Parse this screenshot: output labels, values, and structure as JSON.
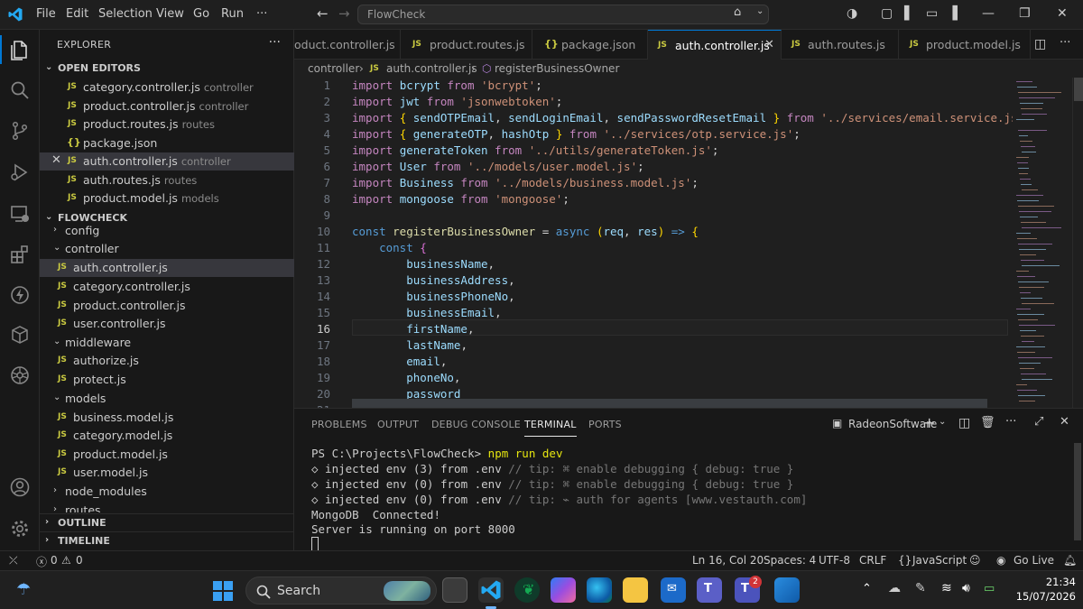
{
  "menu": [
    "File",
    "Edit",
    "Selection",
    "View",
    "Go",
    "Run",
    "···"
  ],
  "command_center": "FlowCheck",
  "explorer": {
    "title": "EXPLORER",
    "open_editors_label": "OPEN EDITORS",
    "open_editors": [
      {
        "name": "category.controller.js",
        "desc": "controller",
        "kind": "js"
      },
      {
        "name": "product.controller.js",
        "desc": "controller",
        "kind": "js"
      },
      {
        "name": "product.routes.js",
        "desc": "routes",
        "kind": "js"
      },
      {
        "name": "package.json",
        "desc": "",
        "kind": "json"
      },
      {
        "name": "auth.controller.js",
        "desc": "controller",
        "kind": "js"
      },
      {
        "name": "auth.routes.js",
        "desc": "routes",
        "kind": "js"
      },
      {
        "name": "product.model.js",
        "desc": "models",
        "kind": "js"
      }
    ],
    "workspace_label": "FLOWCHECK",
    "tree": [
      {
        "name": "config",
        "type": "folder",
        "open": false
      },
      {
        "name": "controller",
        "type": "folder",
        "open": true
      },
      {
        "name": "auth.controller.js",
        "type": "file"
      },
      {
        "name": "category.controller.js",
        "type": "file"
      },
      {
        "name": "product.controller.js",
        "type": "file"
      },
      {
        "name": "user.controller.js",
        "type": "file"
      },
      {
        "name": "middleware",
        "type": "folder",
        "open": true
      },
      {
        "name": "authorize.js",
        "type": "file"
      },
      {
        "name": "protect.js",
        "type": "file"
      },
      {
        "name": "models",
        "type": "folder",
        "open": true
      },
      {
        "name": "business.model.js",
        "type": "file"
      },
      {
        "name": "category.model.js",
        "type": "file"
      },
      {
        "name": "product.model.js",
        "type": "file"
      },
      {
        "name": "user.model.js",
        "type": "file"
      },
      {
        "name": "node_modules",
        "type": "folder",
        "open": false
      },
      {
        "name": "routes",
        "type": "folder",
        "open": false
      }
    ],
    "outline_label": "OUTLINE",
    "timeline_label": "TIMELINE"
  },
  "tabs": [
    {
      "name": "oduct.controller.js",
      "kind": "js",
      "active": false
    },
    {
      "name": "product.routes.js",
      "kind": "js",
      "active": false
    },
    {
      "name": "package.json",
      "kind": "json",
      "active": false
    },
    {
      "name": "auth.controller.js",
      "kind": "js",
      "active": true
    },
    {
      "name": "auth.routes.js",
      "kind": "js",
      "active": false
    },
    {
      "name": "product.model.js",
      "kind": "js",
      "active": false
    }
  ],
  "breadcrumb": [
    "controller",
    "auth.controller.js",
    "registerBusinessOwner"
  ],
  "code": {
    "line_numbers": [
      "1",
      "2",
      "3",
      "4",
      "5",
      "6",
      "7",
      "8",
      "9",
      "10",
      "11",
      "12",
      "13",
      "14",
      "15",
      "16",
      "17",
      "18",
      "19",
      "20",
      "21"
    ],
    "current_line": 16,
    "last_partial": "} = req.body;"
  },
  "panel": {
    "tabs": [
      "PROBLEMS",
      "OUTPUT",
      "DEBUG CONSOLE",
      "TERMINAL",
      "PORTS"
    ],
    "active_tab": "TERMINAL",
    "terminal_name": "RadeonSoftware",
    "lines": [
      {
        "prompt": "PS C:\\Projects\\FlowCheck>",
        "cmd": " npm run dev"
      },
      {
        "a": "◇ injected env (3) from .env ",
        "b": "// tip: ⌘ enable debugging { debug: true }"
      },
      {
        "a": "◇ injected env (0) from .env ",
        "b": "// tip: ⌘ enable debugging { debug: true }"
      },
      {
        "a": "◇ injected env (0) from .env ",
        "b": "// tip: ⌁ auth for agents [www.vestauth.com]"
      },
      {
        "a": "MongoDB  Connected!",
        "b": ""
      },
      {
        "a": "Server is running on port 8000",
        "b": ""
      }
    ]
  },
  "status": {
    "errors": "0",
    "warnings": "0",
    "position": "Ln 16, Col 20",
    "spaces": "Spaces: 4",
    "encoding": "UTF-8",
    "eol": "CRLF",
    "language": "JavaScript",
    "golive": "Go Live"
  },
  "taskbar": {
    "search": "Search",
    "time": "21:34",
    "date": "15/07/2026",
    "teams_badge": "2"
  },
  "colors": {
    "accent": "#0078d4",
    "js_icon": "#cbcb41",
    "keyword": "#c586c0",
    "string": "#ce9178"
  }
}
